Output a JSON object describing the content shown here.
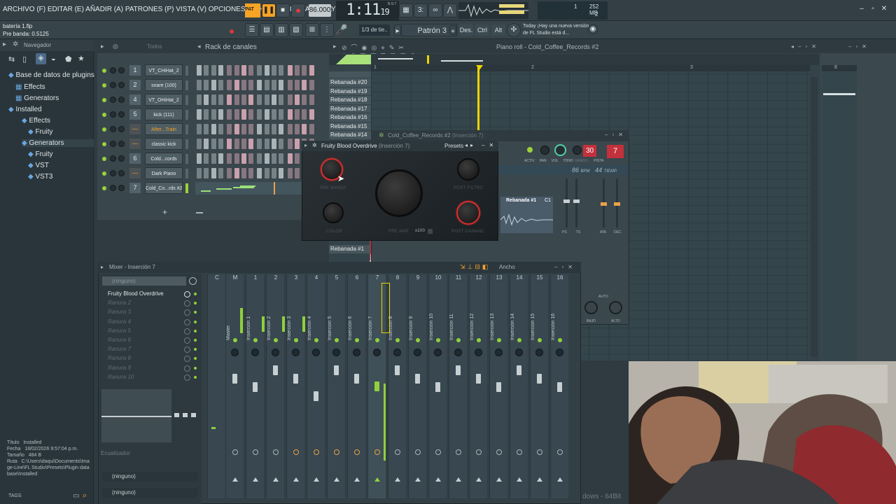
{
  "menu": {
    "items_text": "ARCHIVO (F) EDITAR (E) AÑADIR (A) PATRONES (P) VISTA (V) OPCIONES (O) HERRAMIENTAS (T) AYUDA",
    "pat_label": "PAT",
    "tempo": "86.000",
    "time_main": "1:11",
    "time_sub": "19",
    "time_unit": "B:S:T",
    "cpu_value": "1",
    "mem_value": "252 MB",
    "poly_value": "2"
  },
  "toolbar2": {
    "file_name": "batería 1.flp",
    "hint": "Pre banda: 0.5125",
    "snap": "1/3 de tie..",
    "pattern": "Patrón 3",
    "btn_des": "Des.",
    "btn_ctrl": "Ctrl",
    "btn_alt": "Alt",
    "news_today": "Today",
    "news_text": "¡Hay una nueva versión de FL Studio está d..."
  },
  "browser": {
    "title": "Navegador",
    "items": [
      {
        "label": "Base de datos de plugins",
        "indent": 0
      },
      {
        "label": "Effects",
        "indent": 1
      },
      {
        "label": "Generators",
        "indent": 1
      },
      {
        "label": "Installed",
        "indent": 1
      },
      {
        "label": "Effects",
        "indent": 2
      },
      {
        "label": "Fruity",
        "indent": 3
      },
      {
        "label": "Generators",
        "indent": 2
      },
      {
        "label": "Fruity",
        "indent": 3
      },
      {
        "label": "VST",
        "indent": 3
      },
      {
        "label": "VST3",
        "indent": 3
      }
    ],
    "meta_labels": [
      "Título",
      "Fecha",
      "Tamaño",
      "Ruta"
    ],
    "meta_values": [
      "Installed",
      "18/02/2026 9:57:04 p.m.",
      "484 B",
      "C:\\Users\\daqui\\Documents\\Image-Line\\FL Studio\\Presets\\Plugin database\\Installed"
    ],
    "tags_label": "TAGS"
  },
  "rack": {
    "title": "Rack de canales",
    "filter": "Todos",
    "channels": [
      {
        "num": "1",
        "name": "VT_CHiHat_2"
      },
      {
        "num": "2",
        "name": "snare (100)"
      },
      {
        "num": "4",
        "name": "VT_OHiHat_2"
      },
      {
        "num": "5",
        "name": "kick (111)"
      },
      {
        "num": "---",
        "name": "After...Train"
      },
      {
        "num": "---",
        "name": "classic kick"
      },
      {
        "num": "6",
        "name": "Cold...cords"
      },
      {
        "num": "---",
        "name": "Dark Piano"
      },
      {
        "num": "7",
        "name": "Cold_Co...rds #2"
      }
    ]
  },
  "piano_roll": {
    "title": "Piano roll - Cold_Coffee_Records #2",
    "ruler": [
      "1",
      "2",
      "3"
    ],
    "slices": [
      "Rebanada #20",
      "Rebanada #19",
      "Rebanada #18",
      "Rebanada #17",
      "Rebanada #16",
      "Rebanada #15",
      "Rebanada #14"
    ],
    "bottom_slice": "Rebanada #1"
  },
  "channel_settings": {
    "title": "Cold_Coffee_Records #2",
    "title_suffix": "(Inserción 7)",
    "labels": [
      "ACTIV",
      "PAN",
      "VOL",
      "TONO",
      "RANGO",
      "PISTA"
    ],
    "range_value": "30",
    "track_value": "7",
    "bpm": "86",
    "bpm_label": "BPM",
    "time_value": "44",
    "time_label": "TIEMP.",
    "sample_name": "Rebanada #1",
    "sample_tag": "C1",
    "env_labels": [
      "PS",
      "TS",
      "ATA",
      "DEC"
    ],
    "knob_labels": [
      "BAJO",
      "ALTO"
    ],
    "auto_label": "AUTO"
  },
  "blood_overdrive": {
    "title": "Fruity Blood Overdrive",
    "title_suffix": "(Inserción 7)",
    "presets": "Presets",
    "labels": [
      "PRE BANDA",
      "POST FILTRO",
      "COLOR",
      "PRE AMP",
      "x100",
      "POST GANANC"
    ]
  },
  "mixer": {
    "title": "Mixer - Inserción 7",
    "width_label": "Ancho",
    "top_slot": "(ninguno)",
    "slots": [
      "Fruity Blood Overdrive",
      "Ranura 2",
      "Ranura 3",
      "Ranura 4",
      "Ranura 5",
      "Ranura 6",
      "Ranura 7",
      "Ranura 8",
      "Ranura 9",
      "Ranura 10"
    ],
    "eq_label": "Ecualizador",
    "bottom_slots": [
      "(ninguno)",
      "(ninguno)"
    ],
    "tracks": [
      {
        "num": "C",
        "name": ""
      },
      {
        "num": "M",
        "name": "Master"
      },
      {
        "num": "1",
        "name": "Inserción 1"
      },
      {
        "num": "2",
        "name": "Inserción 2"
      },
      {
        "num": "3",
        "name": "Inserción 3"
      },
      {
        "num": "4",
        "name": "Inserción 4"
      },
      {
        "num": "5",
        "name": "Inserción 5"
      },
      {
        "num": "6",
        "name": "Inserción 6"
      },
      {
        "num": "7",
        "name": "Inserción 7"
      },
      {
        "num": "8",
        "name": "Inserción 8"
      },
      {
        "num": "9",
        "name": "Inserción 9"
      },
      {
        "num": "10",
        "name": "Inserción 10"
      },
      {
        "num": "11",
        "name": "Inserción 11"
      },
      {
        "num": "12",
        "name": "Inserción 12"
      },
      {
        "num": "13",
        "name": "Inserción 13"
      },
      {
        "num": "14",
        "name": "Inserción 14"
      },
      {
        "num": "15",
        "name": "Inserción 15"
      },
      {
        "num": "16",
        "name": "Inserción 16"
      }
    ]
  },
  "watermark": "dows - 64Bit",
  "colors": {
    "accent": "#9bd13a",
    "playhead": "#eed400",
    "danger": "#c3313c",
    "clip": "#a93544"
  }
}
